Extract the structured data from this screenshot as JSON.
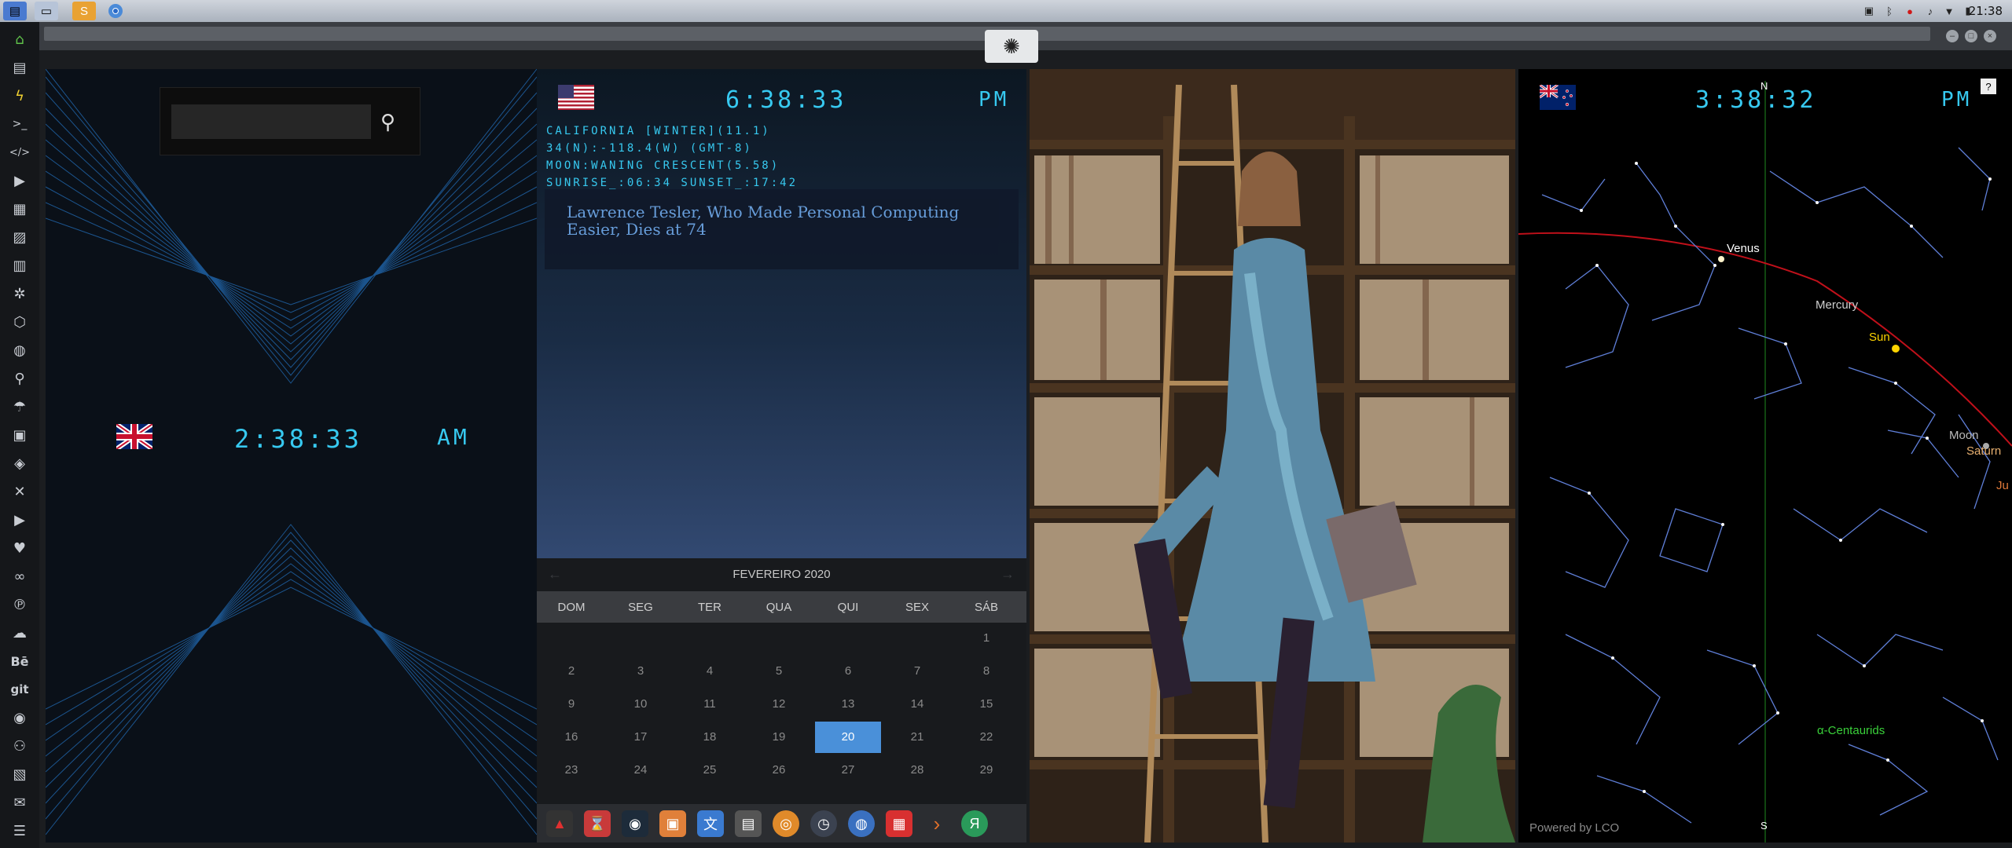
{
  "topbar": {
    "clock": "21:38",
    "apps": [
      "file-manager-icon",
      "window-icon",
      "sublime-icon",
      "chrome-icon"
    ],
    "tray": [
      "image-icon",
      "bluetooth-icon",
      "record-icon",
      "volume-icon",
      "wifi-icon",
      "battery-icon"
    ]
  },
  "sidebar": {
    "icons": [
      "home-icon",
      "document-icon",
      "lightning-icon",
      "terminal-icon",
      "code-icon",
      "play-icon",
      "contacts-icon",
      "image-icon",
      "calendar-icon",
      "atom-icon",
      "network-icon",
      "globe-icon",
      "search-icon",
      "umbrella-icon",
      "id-icon",
      "tag-icon",
      "tools-icon",
      "youtube-icon",
      "heart-icon",
      "link-icon",
      "pinterest-icon",
      "cloud-icon",
      "behance-icon",
      "git-icon",
      "github-icon",
      "users-icon",
      "map-icon",
      "mail-icon",
      "server-icon"
    ],
    "behance_label": "Bē",
    "git_label": "git"
  },
  "uk_clock": {
    "time": "2:38:33",
    "ampm": "AM",
    "flag": "uk-flag-icon",
    "search": {
      "placeholder": ""
    }
  },
  "us_clock": {
    "time": "6:38:33",
    "ampm": "PM",
    "flag": "us-flag-icon",
    "info": [
      "CALIFORNIA [WINTER](11.1)",
      "34(N):-118.4(W) (GMT-8)",
      "MOON:WANING CRESCENT(5.58)",
      "SUNRISE_:06:34 SUNSET_:17:42"
    ],
    "news_title": "Lawrence Tesler, Who Made Personal Computing Easier, Dies at 74"
  },
  "calendar": {
    "month": "FEVEREIRO 2020",
    "prev": "←",
    "next": "→",
    "dow": [
      "DOM",
      "SEG",
      "TER",
      "QUA",
      "QUI",
      "SEX",
      "SÁB"
    ],
    "weeks": [
      [
        "",
        "",
        "",
        "",
        "",
        "",
        "1"
      ],
      [
        "2",
        "3",
        "4",
        "5",
        "6",
        "7",
        "8"
      ],
      [
        "9",
        "10",
        "11",
        "12",
        "13",
        "14",
        "15"
      ],
      [
        "16",
        "17",
        "18",
        "19",
        "20",
        "21",
        "22"
      ],
      [
        "23",
        "24",
        "25",
        "26",
        "27",
        "28",
        "29"
      ]
    ],
    "selected": "20"
  },
  "dock": {
    "icons": [
      "app-red-icon",
      "hourglass-icon",
      "earth-icon",
      "photos-icon",
      "translate-icon",
      "news-icon",
      "search-circle-icon",
      "clock-icon",
      "globe-icon",
      "calendar-icon",
      "arrow-icon",
      "yandex-icon"
    ],
    "yandex_label": "Я"
  },
  "nz_clock": {
    "time": "3:38:32",
    "ampm": "PM",
    "flag": "nz-flag-icon",
    "north": "N",
    "south": "S",
    "help": "?",
    "planets": {
      "venus": "Venus",
      "mercury": "Mercury",
      "sun": "Sun",
      "moon": "Moon",
      "saturn": "Saturn",
      "jupiter": "Ju",
      "centaurids": "α-Centaurids"
    },
    "powered": "Powered by LCO"
  },
  "colors": {
    "lcd": "#37c9f0",
    "calendar_selected": "#4a90d9",
    "ecliptic": "#c0101a",
    "constellation": "#5f7fd8"
  }
}
